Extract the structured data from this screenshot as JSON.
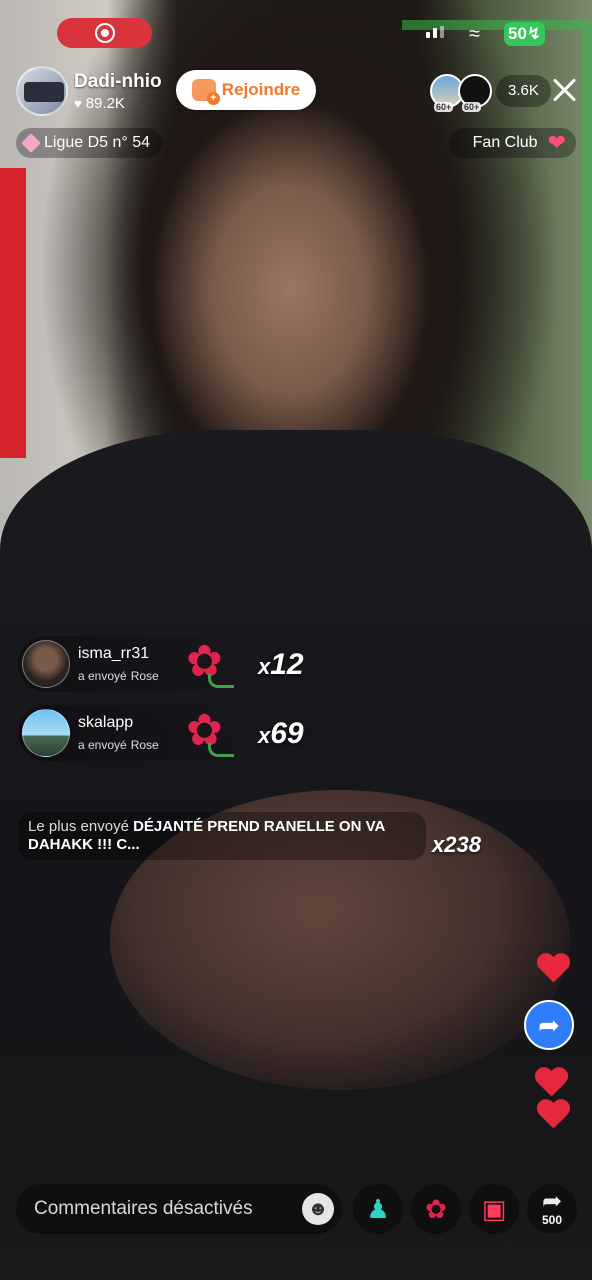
{
  "status_bar": {
    "battery": "50"
  },
  "host": {
    "name": "Dadi-nhio",
    "likes": "89.2K",
    "join_label": "Rejoindre",
    "league": "Ligue D5 n° 54",
    "fan_club": "Fan Club"
  },
  "viewers": {
    "badges": [
      "60+",
      "60+"
    ],
    "count": "3.6K"
  },
  "gifts": [
    {
      "user": "isma_rr31",
      "action": "a envoyé",
      "gift": "Rose",
      "count_prefix": "x",
      "count": "12"
    },
    {
      "user": "skalapp",
      "action": "a envoyé",
      "gift": "Rose",
      "count_prefix": "x",
      "count": "69"
    }
  ],
  "top_sent": {
    "label": "Le plus envoyé",
    "text": "DÉJANTÉ PREND RANELLE ON VA DAHAKK !!! C...",
    "count": "x238"
  },
  "bottom_bar": {
    "comment_placeholder": "Commentaires désactivés",
    "share_count": "500"
  },
  "colors": {
    "rec_red": "#d9343c",
    "join_orange": "#f07a2b",
    "share_blue": "#2f7df6",
    "heart_red": "#e5283c"
  },
  "icons": [
    "record-icon",
    "signal-icon",
    "wifi-icon",
    "battery-icon",
    "heart-icon",
    "close-icon",
    "diamond-icon",
    "fan-club-icon",
    "rose-icon",
    "share-icon",
    "emoji-icon",
    "users-icon",
    "gift-icon"
  ]
}
